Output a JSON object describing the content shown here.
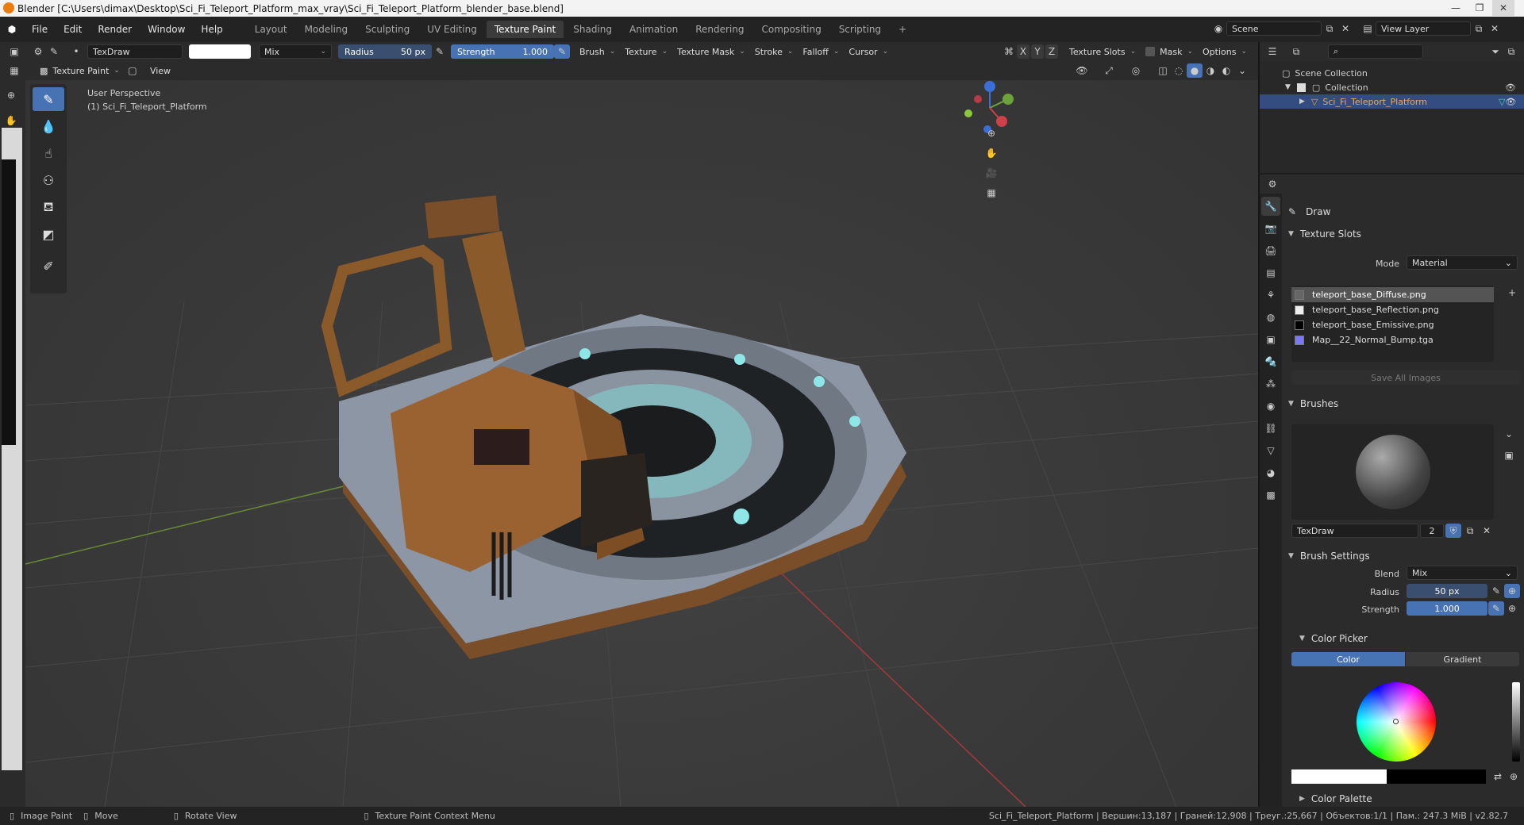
{
  "window": {
    "title": "Blender [C:\\Users\\dimax\\Desktop\\Sci_Fi_Teleport_Platform_max_vray\\Sci_Fi_Teleport_Platform_blender_base.blend]",
    "controls": [
      "—",
      "❐",
      "✕"
    ]
  },
  "menu": [
    "File",
    "Edit",
    "Render",
    "Window",
    "Help"
  ],
  "workspaces": [
    "Layout",
    "Modeling",
    "Sculpting",
    "UV Editing",
    "Texture Paint",
    "Shading",
    "Animation",
    "Rendering",
    "Compositing",
    "Scripting"
  ],
  "active_workspace": "Texture Paint",
  "scene": {
    "name": "Scene",
    "view_layer": "View Layer"
  },
  "tool_header": {
    "brush": "TexDraw",
    "blend": "Mix",
    "radius_label": "Radius",
    "radius_value": "50 px",
    "strength_label": "Strength",
    "strength_value": "1.000",
    "menus": [
      "Brush",
      "Texture",
      "Texture Mask",
      "Stroke",
      "Falloff",
      "Cursor"
    ],
    "axes": [
      "X",
      "Y",
      "Z"
    ],
    "texture_slots": "Texture Slots",
    "mask": "Mask",
    "options": "Options"
  },
  "viewport_header": {
    "mode": "Texture Paint",
    "view": "View"
  },
  "viewport": {
    "perspective": "User Perspective",
    "object": "(1) Sci_Fi_Teleport_Platform",
    "gizmo_axes": [
      "Z",
      "Y",
      "X"
    ]
  },
  "outliner": {
    "root": "Scene Collection",
    "collection": "Collection",
    "object": "Sci_Fi_Teleport_Platform"
  },
  "properties": {
    "tool_name": "Draw",
    "texture_slots_title": "Texture Slots",
    "mode_label": "Mode",
    "mode_value": "Material",
    "slots": [
      "teleport_base_Diffuse.png",
      "teleport_base_Reflection.png",
      "teleport_base_Emissive.png",
      "Map__22_Normal_Bump.tga"
    ],
    "save_all": "Save All Images",
    "brushes_title": "Brushes",
    "brush_name": "TexDraw",
    "brush_users": "2",
    "brush_settings_title": "Brush Settings",
    "blend_label": "Blend",
    "blend_value": "Mix",
    "radius_label": "Radius",
    "radius_value": "50 px",
    "strength_label": "Strength",
    "strength_value": "1.000",
    "color_picker_title": "Color Picker",
    "color_tab": "Color",
    "gradient_tab": "Gradient",
    "color_palette_title": "Color Palette"
  },
  "statusbar": {
    "left": [
      "Image Paint",
      "Move",
      "Rotate View",
      "Texture Paint Context Menu"
    ],
    "right": "Sci_Fi_Teleport_Platform | Вершин:13,187 | Граней:12,908 | Треуг.:25,667 | Объектов:1/1 | Пам.: 247.3 MiB | v2.82.7"
  },
  "colors": {
    "accent": "#4772b3",
    "selection": "#334d80",
    "platform_metal": "#8c96a4",
    "crate_orange": "#9a6231",
    "glow_cyan": "#7fd6d6"
  }
}
